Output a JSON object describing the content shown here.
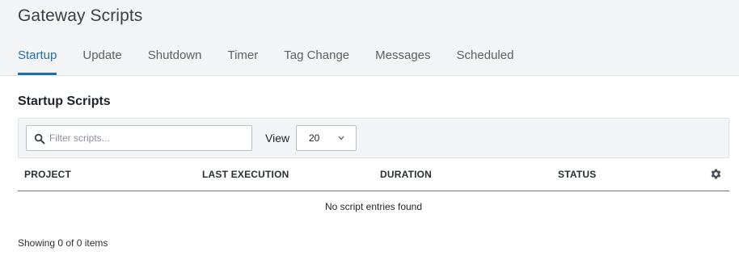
{
  "page": {
    "title": "Gateway Scripts"
  },
  "tabs": [
    {
      "label": "Startup",
      "active": true
    },
    {
      "label": "Update",
      "active": false
    },
    {
      "label": "Shutdown",
      "active": false
    },
    {
      "label": "Timer",
      "active": false
    },
    {
      "label": "Tag Change",
      "active": false
    },
    {
      "label": "Messages",
      "active": false
    },
    {
      "label": "Scheduled",
      "active": false
    }
  ],
  "section": {
    "title": "Startup Scripts"
  },
  "filter": {
    "placeholder": "Filter scripts...",
    "value": "",
    "search_icon": "search-icon"
  },
  "view": {
    "label": "View",
    "selected": "20",
    "chevron_icon": "chevron-down-icon"
  },
  "table": {
    "columns": [
      "PROJECT",
      "LAST EXECUTION",
      "DURATION",
      "STATUS"
    ],
    "settings_icon": "gear-icon",
    "empty_message": "No script entries found",
    "rows": []
  },
  "footer": {
    "count_text": "Showing 0 of 0 items"
  },
  "colors": {
    "accent": "#1f6fa8",
    "header_bg": "#f3f4f6",
    "border": "#dde0e4"
  }
}
